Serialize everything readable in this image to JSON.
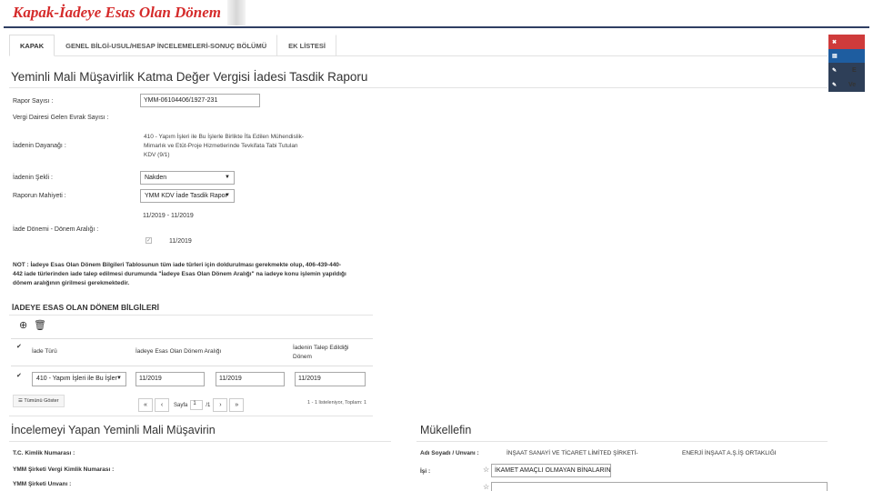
{
  "slide": {
    "title": "Kapak-İadeye Esas Olan Dönem"
  },
  "tabs": [
    {
      "label": "KAPAK"
    },
    {
      "label": "GENEL BİLGİ-USUL/HESAP İNCELEMELERİ-SONUÇ BÖLÜMÜ"
    },
    {
      "label": "EK LİSTESİ"
    }
  ],
  "side_toolbar": [
    {
      "icon": "close-icon",
      "glyph": "✖",
      "label": "",
      "color": "#cf3b3b"
    },
    {
      "icon": "document-icon",
      "glyph": "▤",
      "label": "",
      "color": "#1e5da0"
    },
    {
      "icon": "attach-icon",
      "glyph": "✎",
      "label": "E",
      "color": "#2e3f58"
    },
    {
      "icon": "attach-icon",
      "glyph": "✎",
      "label": "Ve",
      "color": "#2e3f58"
    }
  ],
  "report": {
    "title": "Yeminli Mali Müşavirlik Katma Değer Vergisi İadesi Tasdik Raporu",
    "rapor_sayisi_label": "Rapor Sayısı :",
    "rapor_sayisi_value": "YMM-06104406/1927-231",
    "vergi_dairesi_label": "Vergi Dairesi Gelen Evrak Sayısı :",
    "dayanak_label": "İadenin Dayanağı :",
    "dayanak_value": "410 - Yapım İşleri ile Bu İşlerle Birlikte İfa Edilen Mühendislik-Mimarlık ve Etüt-Proje Hizmetlerinde Tevkifata Tabi Tutulan KDV (9/1)",
    "sekli_label": "İadenin Şekli :",
    "sekli_value": "Nakden",
    "mahiyet_label": "Raporun Mahiyeti :",
    "mahiyet_value": "YMM KDV İade Tasdik Rapor",
    "donem_range": "11/2019 - 11/2019",
    "iade_donemi_label": "İade Dönemi - Dönem Aralığı :",
    "donem_checked": "11/2019",
    "note": "NOT : İadeye Esas Olan Dönem Bilgileri Tablosunun tüm iade türleri için doldurulması gerekmekte olup, 406-439-440-442 iade türlerinden iade talep edilmesi durumunda \"İadeye Esas Olan Dönem Aralığı\" na iadeye konu işlemin yapıldığı dönem aralığının girilmesi gerekmektedir."
  },
  "donem_section": {
    "title": "İADEYE ESAS OLAN DÖNEM BİLGİLERİ",
    "add_icon": "add-circle-icon",
    "delete_icon": "trash-icon",
    "columns": [
      "İade Türü",
      "İadeye Esas Olan Dönem Aralığı",
      "İadenin Talep Edildiği Dönem"
    ],
    "row": {
      "iade_turu": "410 - Yapım İşleri ile Bu İşler",
      "aralik_baslangic": "11/2019",
      "aralik_bitis": "11/2019",
      "talep_donem": "11/2019"
    },
    "show_all": "Tümünü Göster",
    "pager": {
      "page_label": "Sayfa",
      "page_value": "1",
      "page_total": "/1",
      "summary": "1 - 1 listeleniyor, Toplam: 1"
    }
  },
  "ymm_section": {
    "title": "İncelemeyi Yapan Yeminli Mali Müşavirin",
    "tc_label": "T.C. Kimlik Numarası :",
    "vkn_label": "YMM Şirketi Vergi Kimlik Numarası :",
    "unvan_label": "YMM Şirketi Unvanı :"
  },
  "mukellef_section": {
    "title": "Mükellefin",
    "ad_label": "Adı Soyadı / Unvanı :",
    "ad_part1": "İNŞAAT SANAYİ VE TİCARET LİMİTED ŞİRKETİ-",
    "ad_part2": "ENERJİ İNŞAAT A.Ş.İŞ ORTAKLIĞI",
    "isi_label": "İşi :",
    "isi_value": "İKAMET AMAÇLI OLMAYAN BİNALARIN İN"
  }
}
